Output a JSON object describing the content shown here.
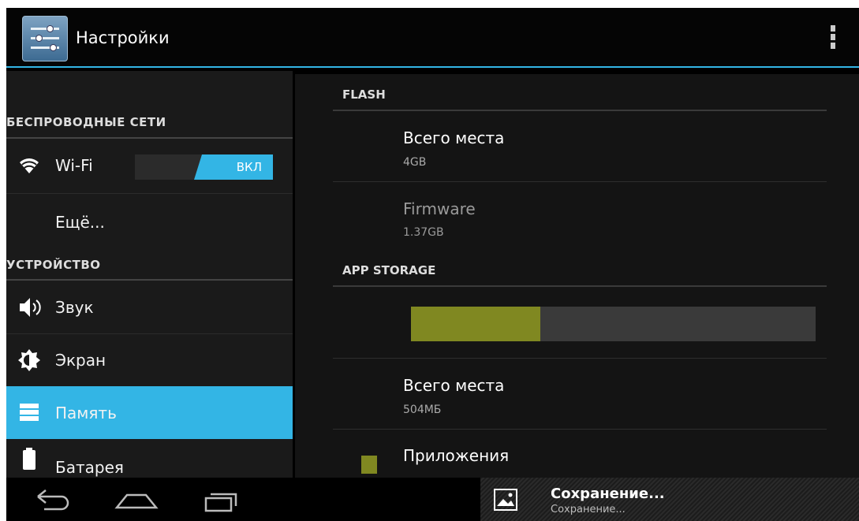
{
  "app": {
    "title": "Настройки",
    "icon": "settings-sliders-icon"
  },
  "overflow_icon": "overflow-menu-icon",
  "accent_color": "#33b5e5",
  "sidebar": {
    "wireless_header": "БЕСПРОВОДНЫЕ СЕТИ",
    "wifi": {
      "label": "Wi-Fi",
      "icon": "wifi-icon",
      "toggle_label": "ВКЛ"
    },
    "more": {
      "label": "Ещё..."
    },
    "device_header": "УСТРОЙСТВО",
    "sound": {
      "label": "Звук",
      "icon": "speaker-icon"
    },
    "display": {
      "label": "Экран",
      "icon": "brightness-icon"
    },
    "storage": {
      "label": "Память",
      "icon": "storage-icon",
      "selected": true
    },
    "battery": {
      "label": "Батарея",
      "icon": "battery-icon"
    }
  },
  "main": {
    "flash": {
      "header": "FLASH",
      "total": {
        "title": "Всего места",
        "value": "4GB"
      },
      "firmware": {
        "title": "Firmware",
        "value": "1.37GB"
      }
    },
    "app_storage": {
      "header": "APP STORAGE",
      "usage_fraction": 0.32,
      "bar_color": "#808821",
      "total": {
        "title": "Всего места",
        "value": "504МБ"
      },
      "apps": {
        "label": "Приложения",
        "color": "#808821"
      }
    }
  },
  "system_bar": {
    "back_icon": "back-icon",
    "home_icon": "home-icon",
    "recents_icon": "recent-apps-icon",
    "notification": {
      "icon": "image-icon",
      "title": "Сохранение...",
      "subtitle": "Сохранение..."
    }
  }
}
